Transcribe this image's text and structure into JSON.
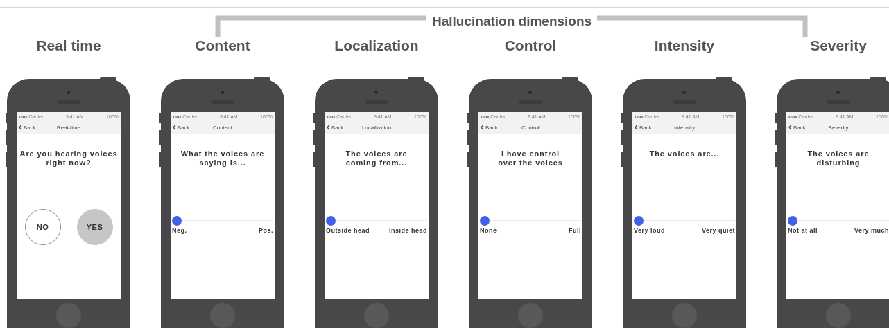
{
  "header": {
    "title": "Hallucination dimensions"
  },
  "phones": [
    {
      "label": "Real time",
      "kind": "choice",
      "status": {
        "carrier": "••••• Carrier",
        "time": "9:41 AM",
        "battery": "100%"
      },
      "nav": {
        "back": "Back",
        "title": "Real-time"
      },
      "question": "Are you hearing voices\nright now?",
      "options": [
        {
          "label": "NO",
          "selected": false
        },
        {
          "label": "YES",
          "selected": true
        }
      ]
    },
    {
      "label": "Content",
      "kind": "slider",
      "status": {
        "carrier": "••••• Carrier",
        "time": "9:41 AM",
        "battery": "100%"
      },
      "nav": {
        "back": "Back",
        "title": "Content"
      },
      "question": "What the voices are\nsaying is...",
      "level": 0,
      "min_label": "Neg.",
      "max_label": "Pos."
    },
    {
      "label": "Localization",
      "kind": "slider",
      "status": {
        "carrier": "••••• Carrier",
        "time": "9:41 AM",
        "battery": "100%"
      },
      "nav": {
        "back": "Back",
        "title": "Localization"
      },
      "question": "The voices are\ncoming from...",
      "level": 0,
      "min_label": "Outside head",
      "max_label": "Inside head"
    },
    {
      "label": "Control",
      "kind": "slider",
      "status": {
        "carrier": "••••• Carrier",
        "time": "9:41 AM",
        "battery": "100%"
      },
      "nav": {
        "back": "Back",
        "title": "Control"
      },
      "question": "I have control\nover the voices",
      "level": 0,
      "min_label": "None",
      "max_label": "Full"
    },
    {
      "label": "Intensity",
      "kind": "slider",
      "status": {
        "carrier": "••••• Carrier",
        "time": "9:41 AM",
        "battery": "100%"
      },
      "nav": {
        "back": "Back",
        "title": "Intensity"
      },
      "question": "The voices are...",
      "level": 0,
      "min_label": "Very loud",
      "max_label": "Very quiet"
    },
    {
      "label": "Severity",
      "kind": "slider",
      "status": {
        "carrier": "••••• Carrier",
        "time": "9:41 AM",
        "battery": "100%"
      },
      "nav": {
        "back": "Back",
        "title": "Severity"
      },
      "question": "The voices are\ndisturbing",
      "level": 0,
      "min_label": "Not at all",
      "max_label": "Very much"
    }
  ]
}
